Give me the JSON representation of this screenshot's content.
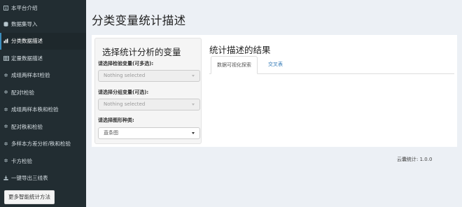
{
  "sidebar": {
    "items": [
      {
        "label": "本平台介绍",
        "icon": "info-square-icon"
      },
      {
        "label": "数据集导入",
        "icon": "database-icon"
      },
      {
        "label": "分类数据描述",
        "icon": "bar-chart-icon",
        "active": true
      },
      {
        "label": "定量数据描述",
        "icon": "table-icon"
      },
      {
        "label": "成组两样本t检验",
        "icon": "gear-icon"
      },
      {
        "label": "配对t检验",
        "icon": "gear-icon"
      },
      {
        "label": "成组两样本秩和检验",
        "icon": "gear-icon"
      },
      {
        "label": "配对秩和检验",
        "icon": "gear-icon"
      },
      {
        "label": "多样本方差分析/秩和检验",
        "icon": "gear-icon"
      },
      {
        "label": "卡方检验",
        "icon": "gear-icon"
      },
      {
        "label": "一键导出三线表",
        "icon": "download-icon"
      }
    ],
    "more_button": "更多智能统计方法"
  },
  "header": {
    "title": "分类变量统计描述"
  },
  "left_panel": {
    "title": "选择统计分析的变量",
    "fields": [
      {
        "label": "请选择检验变量(可多选):",
        "value": "Nothing selected"
      },
      {
        "label": "请选择分组变量(可选):",
        "value": "Nothing selected"
      },
      {
        "label": "请选择图形种类:",
        "value": "直条图"
      }
    ]
  },
  "results": {
    "title": "统计描述的结果",
    "tabs": [
      {
        "label": "数据可视化探索"
      },
      {
        "label": "交叉表"
      }
    ]
  },
  "footer": {
    "text": "云囊统计: 1.0.0"
  },
  "colors": {
    "sidebar_bg": "#222d32",
    "accent": "#3c8dbc",
    "link": "#337ab7",
    "content_bg": "#ecf0f5"
  }
}
